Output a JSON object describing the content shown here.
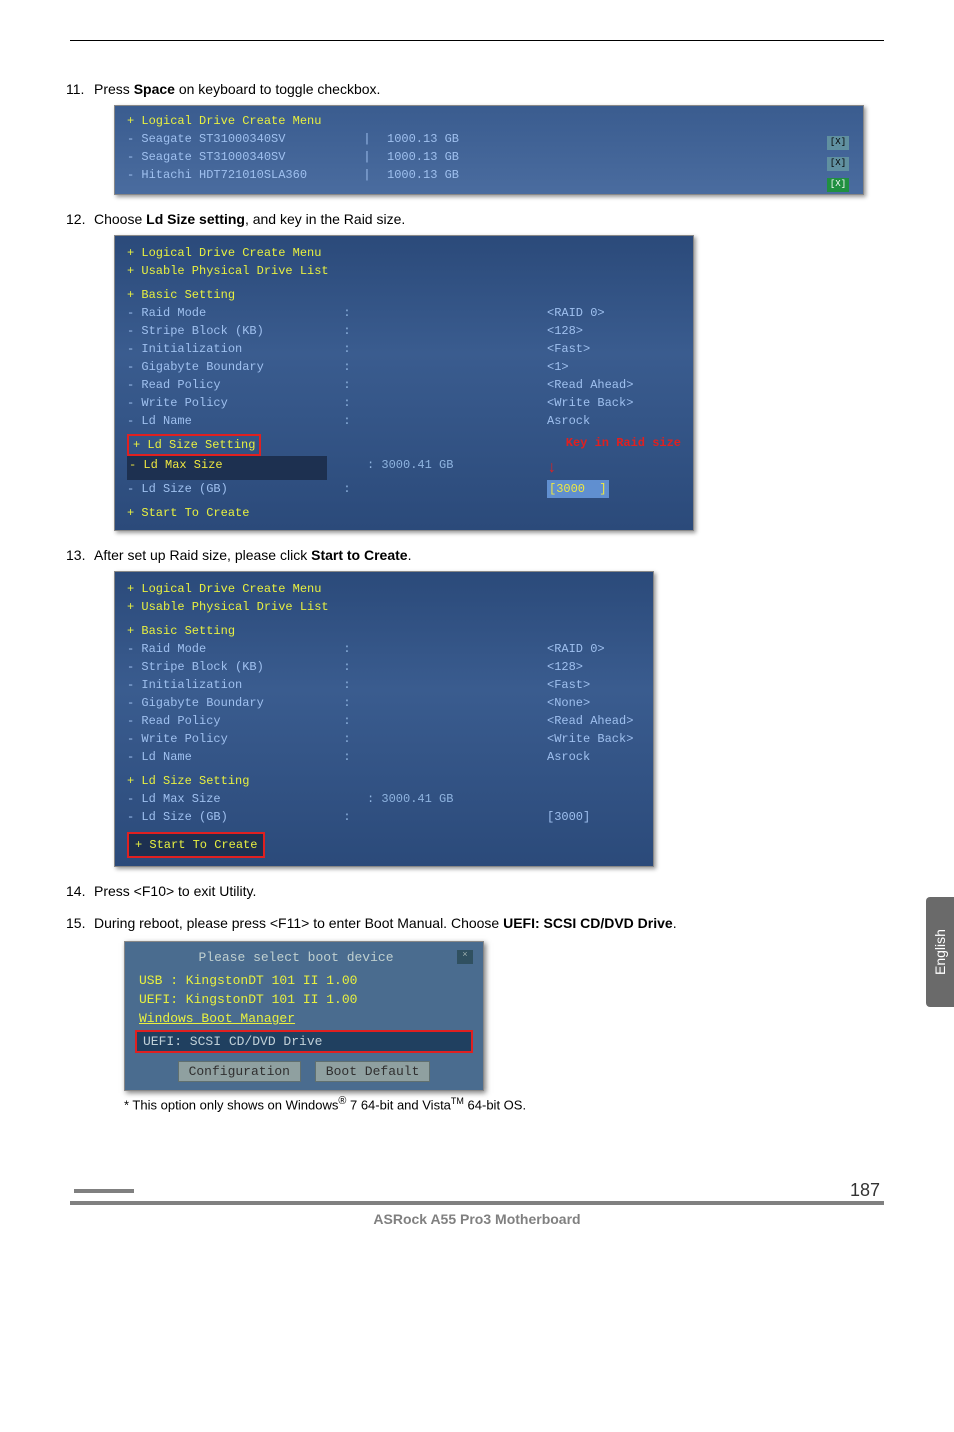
{
  "steps": {
    "s11": {
      "num": "11.",
      "text_pre": "Press ",
      "bold": "Space",
      "text_post": " on keyboard to toggle checkbox."
    },
    "s12": {
      "num": "12.",
      "text_pre": "Choose ",
      "bold": "Ld Size setting",
      "text_post": ", and key in the Raid size."
    },
    "s13": {
      "num": "13.",
      "text_pre": "After set up Raid size, please click ",
      "bold": "Start to Create",
      "text_post": "."
    },
    "s14": {
      "num": "14.",
      "text": "Press <F10> to exit Utility."
    },
    "s15": {
      "num": "15.",
      "text_pre": "During reboot, please press <F11> to enter Boot Manual. Choose ",
      "bold": "UEFI: SCSI CD/DVD Drive",
      "text_post": "."
    }
  },
  "bios11": {
    "title": "+ Logical Drive Create Menu",
    "drives": [
      {
        "name": "- Seagate ST31000340SV",
        "sep": "|",
        "size": "1000.13 GB"
      },
      {
        "name": "- Seagate ST31000340SV",
        "sep": "|",
        "size": "1000.13 GB"
      },
      {
        "name": "- Hitachi HDT721010SLA360",
        "sep": "|",
        "size": "1000.13 GB"
      }
    ],
    "checks": [
      "[X]",
      "[X]",
      "[X]"
    ]
  },
  "bios12": {
    "title": "+ Logical Drive Create Menu",
    "sub": "+ Usable Physical Drive List",
    "basic_title": "+ Basic Setting",
    "rows": [
      {
        "label": "- Raid Mode",
        "val": "<RAID 0>"
      },
      {
        "label": "- Stripe Block (KB)",
        "val": "<128>"
      },
      {
        "label": "- Initialization",
        "val": "<Fast>"
      },
      {
        "label": "- Gigabyte Boundary",
        "val": "<1>"
      },
      {
        "label": "- Read Policy",
        "val": "<Read Ahead>"
      },
      {
        "label": "- Write Policy",
        "val": "<Write Back>"
      },
      {
        "label": "- Ld Name",
        "val": "Asrock"
      }
    ],
    "ldsize": "+ Ld Size Setting",
    "annot": "Key in Raid size",
    "arrow": "↓",
    "max_label": "- Ld Max Size",
    "max_val": ": 3000.41 GB",
    "size_label": "- Ld Size (GB)",
    "size_colon": ":",
    "size_input_l": "[",
    "size_input_v": "3000",
    "size_input_r": "]",
    "foot": "+ Start To Create"
  },
  "bios13": {
    "title": "+ Logical Drive Create Menu",
    "sub": "+ Usable Physical Drive List",
    "basic_title": "+ Basic Setting",
    "rows": [
      {
        "label": "- Raid Mode",
        "val": "<RAID 0>"
      },
      {
        "label": "- Stripe Block (KB)",
        "val": "<128>"
      },
      {
        "label": "- Initialization",
        "val": "<Fast>"
      },
      {
        "label": "- Gigabyte Boundary",
        "val": "<None>"
      },
      {
        "label": "- Read Policy",
        "val": "<Read Ahead>"
      },
      {
        "label": "- Write Policy",
        "val": "<Write Back>"
      },
      {
        "label": "- Ld Name",
        "val": "Asrock"
      }
    ],
    "ldsize_title": "+ Ld Size Setting",
    "max_label": "- Ld Max Size",
    "max_val": ": 3000.41 GB",
    "size_label": "- Ld Size (GB)",
    "size_colon": ":",
    "size_val": "[3000]",
    "start": "+ Start To Create"
  },
  "boot": {
    "title": "Please select boot device",
    "close": "×",
    "items": [
      "USB : KingstonDT 101 II 1.00",
      "UEFI: KingstonDT 101 II 1.00",
      "Windows Boot Manager"
    ],
    "selected": "UEFI: SCSI CD/DVD Drive",
    "btn1": "Configuration",
    "btn2": "Boot Default"
  },
  "footnote": {
    "pre": "* This option only shows on Windows",
    "reg": "®",
    "mid": " 7 64-bit and Vista",
    "tm": "TM",
    "post": " 64-bit OS."
  },
  "side_tab": "English",
  "footer": {
    "title": "ASRock  A55 Pro3  Motherboard",
    "page": "187"
  }
}
